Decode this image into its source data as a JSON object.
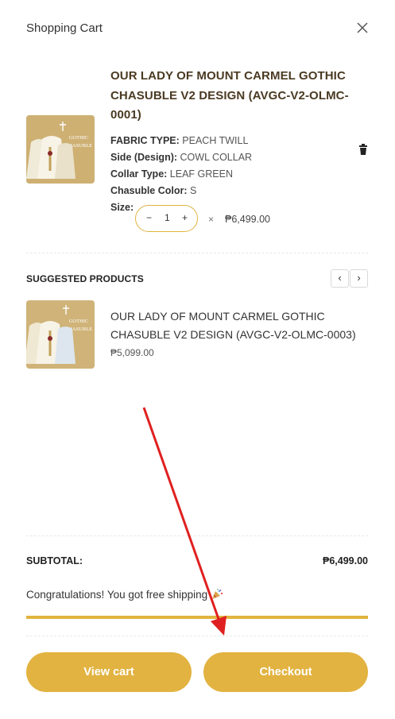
{
  "header": {
    "title": "Shopping Cart",
    "close_icon": "close-icon"
  },
  "cart_item": {
    "title": "OUR LADY OF MOUNT CARMEL GOTHIC CHASUBLE V2 DESIGN (AVGC-V2-OLMC-0001)",
    "fabric_label": "FABRIC TYPE:",
    "fabric_value": "PEACH TWILL",
    "side_label": "Side (Design):",
    "side_value": "COWL COLLAR",
    "collar_label": "Collar Type:",
    "collar_value": "LEAF GREEN",
    "color_label": "Chasuble Color:",
    "color_value": "S",
    "size_label": "Size:",
    "qty_minus": "−",
    "qty_value": "1",
    "qty_plus": "+",
    "times": "×",
    "price": "₱6,499.00",
    "image_text_1": "GOTHIC",
    "image_text_2": "CHASUBLE",
    "trash_icon": "trash-icon"
  },
  "suggested": {
    "heading": "SUGGESTED PRODUCTS",
    "prev": "‹",
    "next": "›",
    "items": [
      {
        "name": "OUR LADY OF MOUNT CARMEL GOTHIC CHASUBLE V2 DESIGN (AVGC-V2-OLMC-0003)",
        "price": "₱5,099.00",
        "image_text_1": "GOTHIC",
        "image_text_2": "CHASUBLE"
      }
    ]
  },
  "summary": {
    "subtotal_label": "SUBTOTAL:",
    "subtotal_value": "₱6,499.00",
    "free_shipping_text": "Congratulations! You got free shipping",
    "free_shipping_progress": 1.0
  },
  "actions": {
    "view_cart": "View cart",
    "checkout": "Checkout"
  },
  "colors": {
    "accent": "#e2b341",
    "annotation_arrow": "#e02020"
  }
}
